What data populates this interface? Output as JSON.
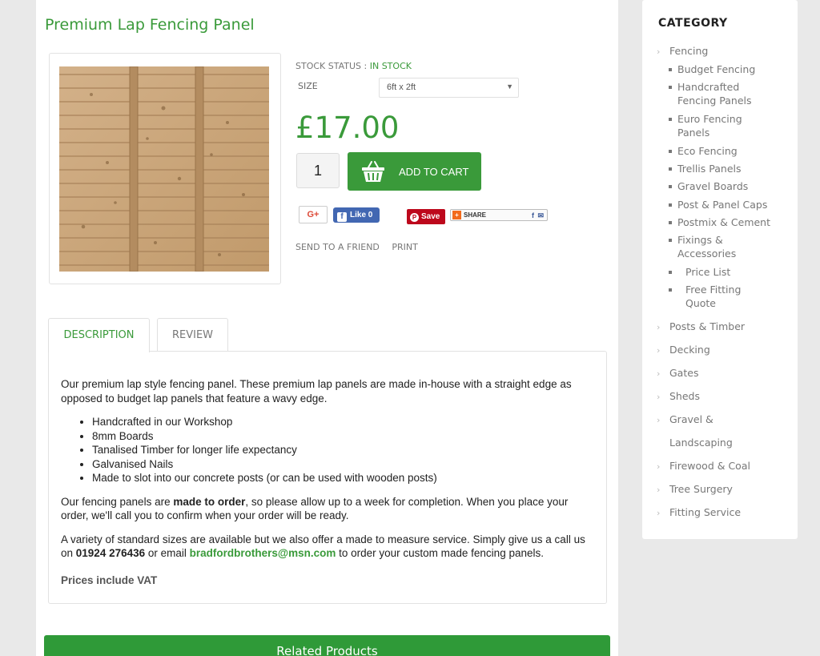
{
  "product": {
    "title": "Premium Lap Fencing Panel",
    "stock_label": "STOCK STATUS : ",
    "stock_value": "IN STOCK",
    "size_label": "SIZE",
    "size_selected": "6ft x 2ft",
    "price": "£17.00",
    "quantity": "1",
    "add_to_cart": "ADD TO CART"
  },
  "social": {
    "gplus": "G+",
    "fb_like": "Like 0",
    "pin_save": "Save",
    "share": "SHARE"
  },
  "links": {
    "send_to_friend": "SEND TO A FRIEND",
    "print": "PRINT"
  },
  "tabs": {
    "description": "DESCRIPTION",
    "review": "REVIEW"
  },
  "description": {
    "intro": "Our premium lap style fencing panel. These premium lap panels are made in-house with a straight edge as opposed to budget lap panels that feature a wavy edge.",
    "features": [
      "Handcrafted in our Workshop",
      "8mm Boards",
      "Tanalised Timber for longer life expectancy",
      "Galvanised Nails",
      "Made to slot into our concrete posts (or can be used with wooden posts)"
    ],
    "made_order_pre": "Our fencing panels are ",
    "made_order_bold": "made to order",
    "made_order_post": ", so please allow up to a week for completion. When you place your order, we'll call you to confirm when your order will be ready.",
    "measure_pre": "A variety of standard sizes are available but we also offer a made to measure service. Simply give us a call us on ",
    "phone": "01924 276436",
    "measure_mid": " or email ",
    "email": "bradfordbrothers@msn.com",
    "measure_post": " to order your custom made fencing panels.",
    "vat": "Prices include VAT"
  },
  "related_title": "Related Products",
  "sidebar": {
    "title": "CATEGORY",
    "fencing": "Fencing",
    "fencing_sub": [
      "Budget Fencing",
      "Handcrafted Fencing Panels",
      "Euro Fencing Panels",
      "Eco Fencing",
      "Trellis Panels",
      "Gravel Boards",
      "Post & Panel Caps",
      "Postmix & Cement",
      "Fixings & Accessories",
      "Price List",
      "Free Fitting Quote"
    ],
    "others": [
      "Posts & Timber",
      "Decking",
      "Gates",
      "Sheds",
      "Gravel &",
      "Landscaping",
      "Firewood & Coal",
      "Tree Surgery",
      "Fitting Service"
    ]
  },
  "colors": {
    "accent": "#3a9a3a",
    "related_bar": "#2f9a38"
  }
}
